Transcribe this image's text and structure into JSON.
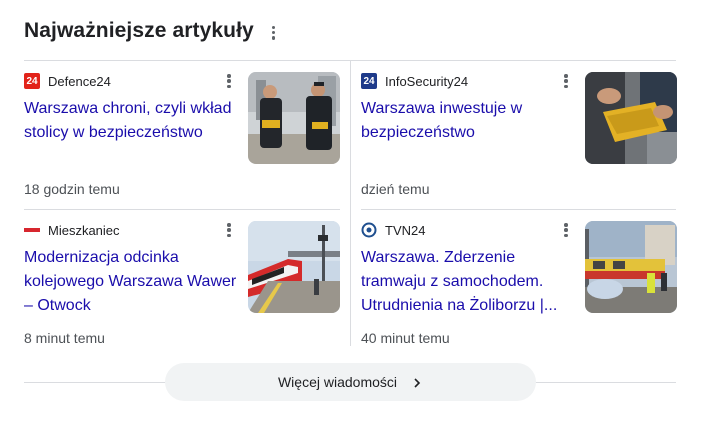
{
  "header": {
    "title": "Najważniejsze artykuły"
  },
  "articles": [
    {
      "source": "Defence24",
      "favicon_text": "24",
      "favicon_color": "#e2231a",
      "title": "Warszawa chroni, czyli wkład stolicy w bezpieczeństwo",
      "time": "18 godzin temu"
    },
    {
      "source": "InfoSecurity24",
      "favicon_text": "24",
      "favicon_color": "#1e3a8a",
      "title": "Warszawa inwestuje w bezpieczeństwo",
      "time": "dzień temu"
    },
    {
      "source": "Mieszkaniec",
      "favicon_text": "",
      "favicon_color": "#d7262e",
      "title": "Modernizacja odcinka kolejowego Warszawa Wawer – Otwock",
      "time": "8 minut temu"
    },
    {
      "source": "TVN24",
      "favicon_text": "",
      "favicon_color": "#1f4f8f",
      "title": "Warszawa. Zderzenie tramwaju z samochodem. Utrudnienia na Żoliborzu |...",
      "time": "40 minut temu"
    }
  ],
  "more_button": {
    "label": "Więcej wiadomości"
  },
  "colors": {
    "link": "#1a0dab",
    "divider": "#dadce0",
    "button_bg": "#f1f3f4"
  }
}
